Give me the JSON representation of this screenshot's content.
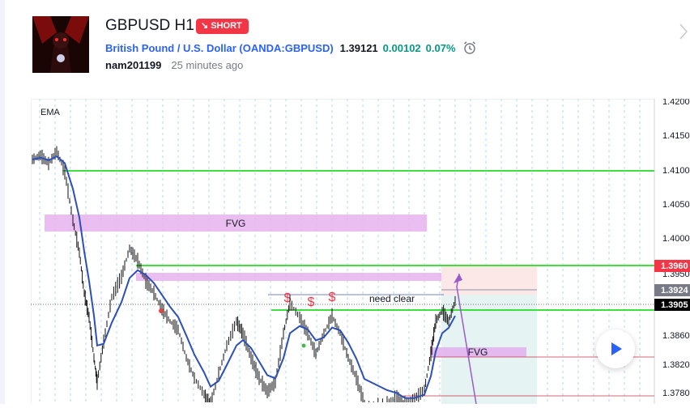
{
  "idea": {
    "title": "GBPUSD H1",
    "badge": "SHORT",
    "symbol_name": "British Pound / U.S. Dollar (OANDA:GBPUSD)",
    "price": "1.39121",
    "change": "0.00102",
    "change_pct": "0.07%",
    "author": "nam201199",
    "time_ago": "25 minutes ago"
  },
  "chart": {
    "indicator": "EMA",
    "axis_labels": [
      "1.4200",
      "1.4150",
      "1.4100",
      "1.4050",
      "1.4000",
      "1.3950",
      "1.3860",
      "1.3820",
      "1.3780"
    ],
    "price_tags": [
      "1.3960",
      "1.3924",
      "1.3905"
    ],
    "annotations": {
      "fvg_top": "FVG",
      "fvg_bottom": "FVG",
      "need_clear": "need clear",
      "dollar": "$"
    }
  },
  "colors": {
    "accent": "#2962ff",
    "short": "#f23645",
    "positive": "#089981",
    "level_line": "#22dd22",
    "zone": "#e8b3ee",
    "ema": "#2c4fb8"
  }
}
